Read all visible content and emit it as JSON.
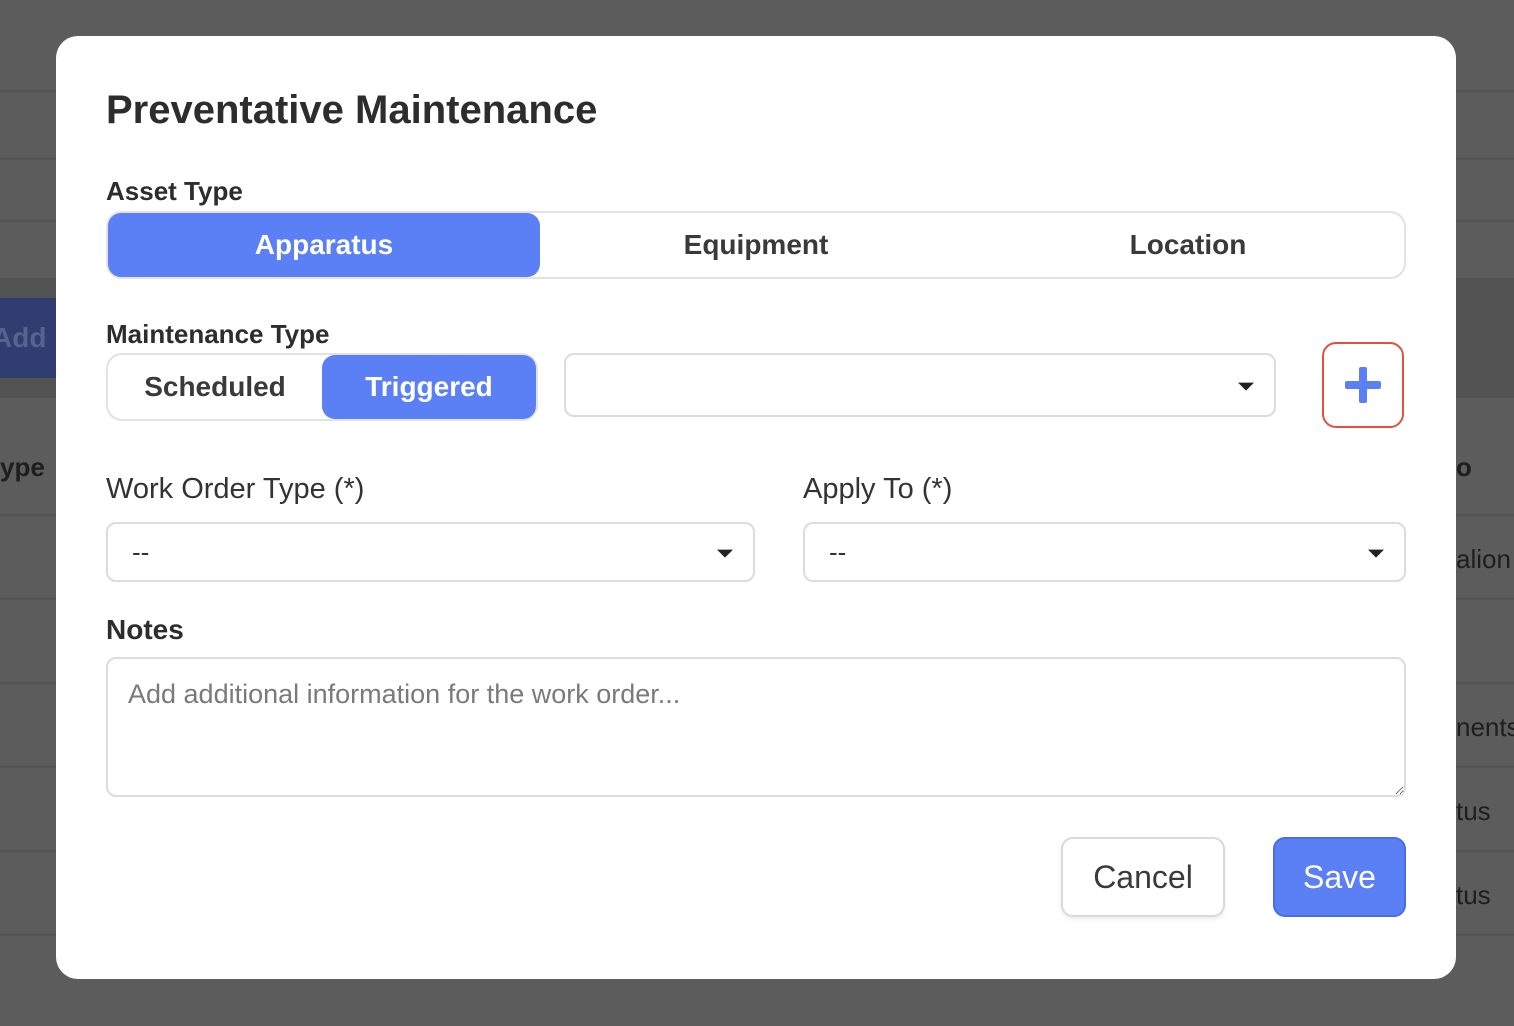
{
  "background": {
    "button_label": "Add N",
    "snippets": [
      "ype",
      "o",
      "alion",
      "nents",
      "tus",
      "tus"
    ]
  },
  "modal": {
    "title": "Preventative Maintenance",
    "asset_type": {
      "label": "Asset Type",
      "options": [
        "Apparatus",
        "Equipment",
        "Location"
      ],
      "selected": "Apparatus"
    },
    "maintenance_type": {
      "label": "Maintenance Type",
      "options": [
        "Scheduled",
        "Triggered"
      ],
      "selected": "Triggered",
      "trigger_select_value": ""
    },
    "work_order_type": {
      "label": "Work Order Type (*)",
      "value": "--"
    },
    "apply_to": {
      "label": "Apply To (*)",
      "value": "--"
    },
    "notes": {
      "label": "Notes",
      "placeholder": "Add additional information for the work order..."
    },
    "buttons": {
      "cancel": "Cancel",
      "save": "Save"
    },
    "colors": {
      "accent": "#5b7ff5",
      "add_button_border": "#e0513f"
    }
  }
}
